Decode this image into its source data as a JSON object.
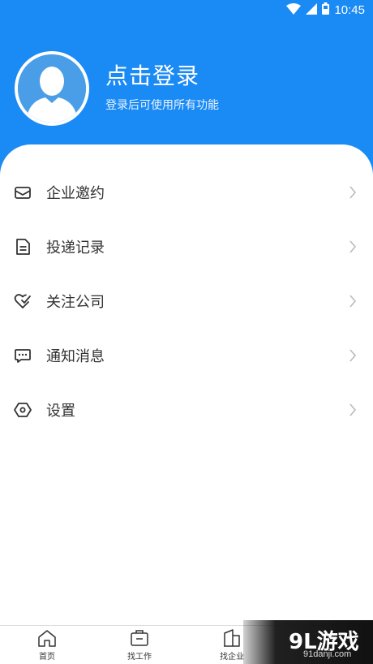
{
  "status_bar": {
    "time": "10:45"
  },
  "profile": {
    "title": "点击登录",
    "subtitle": "登录后可使用所有功能"
  },
  "menu": [
    {
      "icon": "envelope-icon",
      "label": "企业邀约"
    },
    {
      "icon": "document-icon",
      "label": "投递记录"
    },
    {
      "icon": "heart-check-icon",
      "label": "关注公司"
    },
    {
      "icon": "chat-bubble-icon",
      "label": "通知消息"
    },
    {
      "icon": "settings-hexagon-icon",
      "label": "设置"
    }
  ],
  "bottom_nav": [
    {
      "icon": "home-icon",
      "label": "首页"
    },
    {
      "icon": "briefcase-icon",
      "label": "找工作"
    },
    {
      "icon": "building-icon",
      "label": "找企业"
    }
  ],
  "watermark": {
    "brand": "9L游戏",
    "url": "91danji.com"
  },
  "colors": {
    "primary": "#1a8af5",
    "text": "#333333",
    "chevron": "#bbbbbb"
  }
}
